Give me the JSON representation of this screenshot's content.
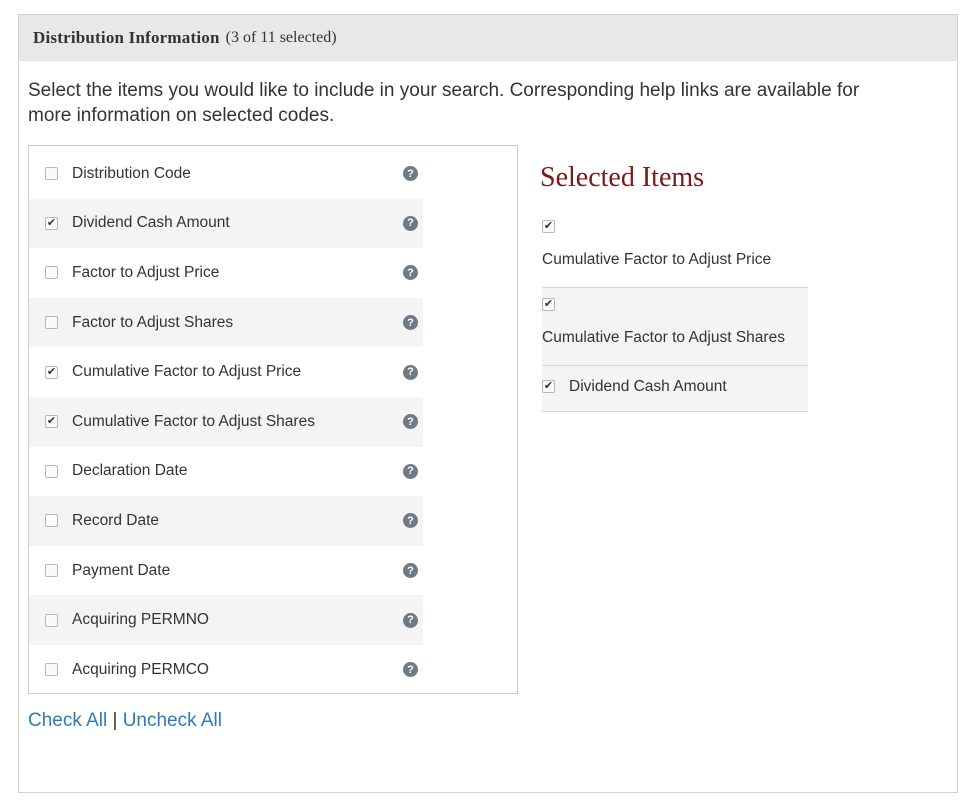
{
  "header": {
    "title": "Distribution Information",
    "count": "(3 of 11 selected)"
  },
  "intro": "Select the items you would like to include in your search. Corresponding help links are available for more information on selected codes.",
  "items": [
    {
      "label": "Distribution Code",
      "checked": false
    },
    {
      "label": "Dividend Cash Amount",
      "checked": true
    },
    {
      "label": "Factor to Adjust Price",
      "checked": false
    },
    {
      "label": "Factor to Adjust Shares",
      "checked": false
    },
    {
      "label": "Cumulative Factor to Adjust Price",
      "checked": true
    },
    {
      "label": "Cumulative Factor to Adjust Shares",
      "checked": true
    },
    {
      "label": "Declaration Date",
      "checked": false
    },
    {
      "label": "Record Date",
      "checked": false
    },
    {
      "label": "Payment Date",
      "checked": false
    },
    {
      "label": "Acquiring PERMNO",
      "checked": false
    },
    {
      "label": "Acquiring PERMCO",
      "checked": false
    }
  ],
  "help_glyph": "?",
  "links": {
    "check_all": "Check All",
    "separator": "|",
    "uncheck_all": "Uncheck All"
  },
  "selected": {
    "title": "Selected Items",
    "items": [
      {
        "label": "Cumulative Factor to Adjust Price",
        "checked": true
      },
      {
        "label": "Cumulative Factor to Adjust Shares",
        "checked": true
      },
      {
        "label": "Dividend Cash Amount",
        "checked": true
      }
    ]
  },
  "colors": {
    "link": "#2b7bb9",
    "selected_title": "#7a1a18",
    "help_icon": "#6e7b87",
    "header_bg": "#e8e8e8"
  }
}
